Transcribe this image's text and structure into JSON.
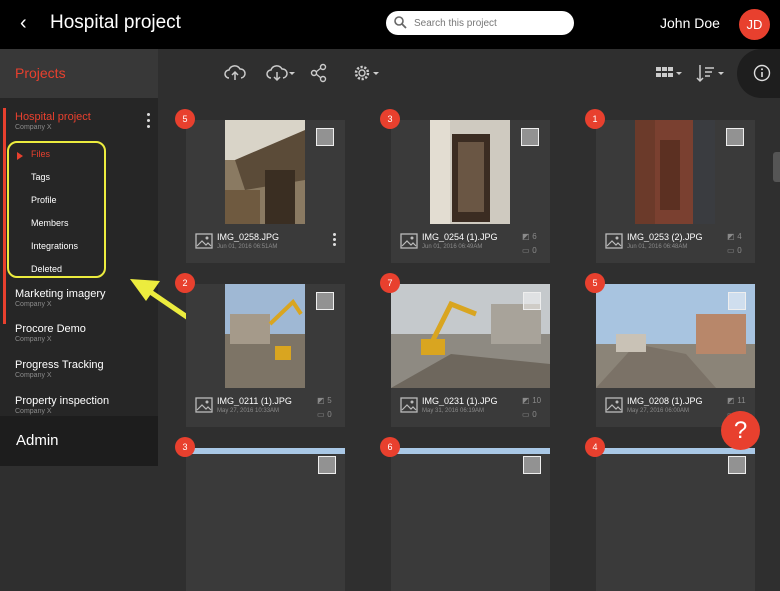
{
  "header": {
    "back_glyph": "‹",
    "title": "Hospital project",
    "search_placeholder": "Search this project",
    "user_name": "John Doe",
    "user_initials": "JD"
  },
  "sidebar": {
    "projects_label": "Projects",
    "projects": [
      {
        "name": "Hospital project",
        "company": "Company X",
        "active": true
      },
      {
        "name": "Marketing imagery",
        "company": "Company X"
      },
      {
        "name": "Procore Demo",
        "company": "Company X"
      },
      {
        "name": "Progress Tracking",
        "company": "Company X"
      },
      {
        "name": "Property inspection",
        "company": "Company X"
      }
    ],
    "submenu": [
      "Files",
      "Tags",
      "Profile",
      "Members",
      "Integrations",
      "Deleted"
    ],
    "admin_label": "Admin"
  },
  "toolbar": {
    "icons": [
      "menu-collapse-icon",
      "cloud-upload-icon",
      "cloud-download-icon",
      "share-icon",
      "settings-icon",
      "grid-view-icon",
      "sort-icon",
      "info-icon"
    ]
  },
  "files": [
    {
      "badge": "5",
      "name": "IMG_0258.JPG",
      "date": "Jun 01, 2016 06:51AM",
      "tags": "",
      "comments": "",
      "scene": "interior"
    },
    {
      "badge": "3",
      "name": "IMG_0254 (1).JPG",
      "date": "Jun 01, 2016 06:49AM",
      "tags": "6",
      "comments": "0",
      "scene": "door"
    },
    {
      "badge": "1",
      "name": "IMG_0253 (2).JPG",
      "date": "Jun 01, 2016 06:48AM",
      "tags": "4",
      "comments": "0",
      "scene": "brick"
    },
    {
      "badge": "2",
      "name": "IMG_0211 (1).JPG",
      "date": "May 27, 2016 10:33AM",
      "tags": "5",
      "comments": "0",
      "scene": "demolition"
    },
    {
      "badge": "7",
      "name": "IMG_0231 (1).JPG",
      "date": "May 31, 2016 06:19AM",
      "tags": "10",
      "comments": "0",
      "scene": "excavator"
    },
    {
      "badge": "5",
      "name": "IMG_0208 (1).JPG",
      "date": "May 27, 2016 06:00AM",
      "tags": "11",
      "comments": "0",
      "scene": "site"
    },
    {
      "badge": "3",
      "name": "",
      "date": "",
      "tags": "",
      "comments": "",
      "scene": "sky"
    },
    {
      "badge": "6",
      "name": "",
      "date": "",
      "tags": "",
      "comments": "",
      "scene": "sky"
    },
    {
      "badge": "4",
      "name": "",
      "date": "",
      "tags": "",
      "comments": "",
      "scene": "sky"
    }
  ],
  "help_label": "?",
  "colors": {
    "accent": "#e8402e",
    "highlight": "#ecec3e",
    "background": "#2f2f2f"
  }
}
